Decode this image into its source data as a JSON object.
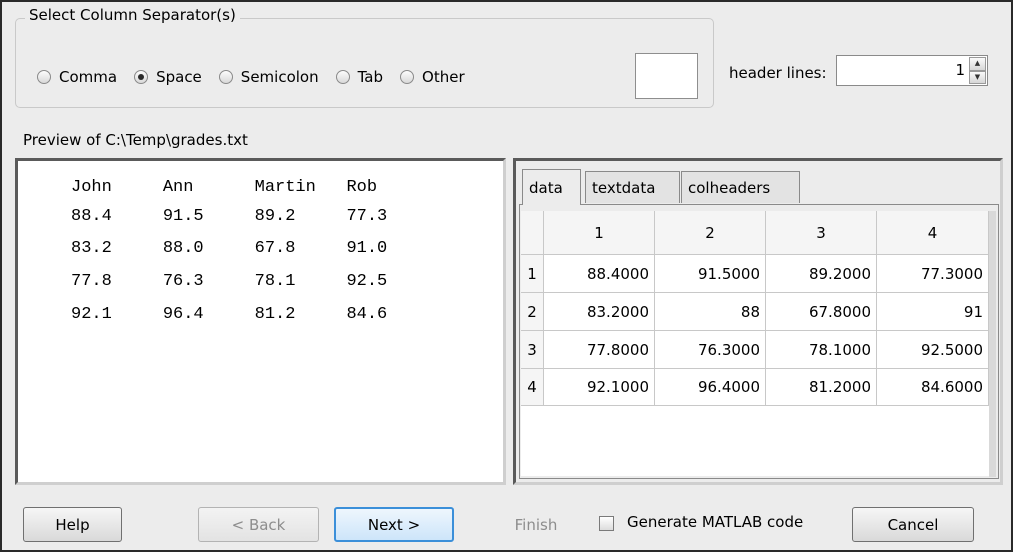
{
  "separator": {
    "title": "Select Column Separator(s)",
    "options": [
      {
        "label": "Comma",
        "checked": false
      },
      {
        "label": "Space",
        "checked": true
      },
      {
        "label": "Semicolon",
        "checked": false
      },
      {
        "label": "Tab",
        "checked": false
      },
      {
        "label": "Other",
        "checked": false
      }
    ],
    "other_value": ""
  },
  "header_lines": {
    "label": "header lines:",
    "value": "1"
  },
  "preview": {
    "label": "Preview of C:\\Temp\\grades.txt",
    "lines": [
      "John     Ann      Martin   Rob",
      "88.4     91.5     89.2     77.3",
      "83.2     88.0     67.8     91.0",
      "77.8     76.3     78.1     92.5",
      "92.1     96.4     81.2     84.6"
    ]
  },
  "tabs": [
    {
      "label": "data",
      "active": true
    },
    {
      "label": "textdata",
      "active": false
    },
    {
      "label": "colheaders",
      "active": false
    }
  ],
  "table": {
    "col_headers": [
      "1",
      "2",
      "3",
      "4"
    ],
    "row_headers": [
      "1",
      "2",
      "3",
      "4"
    ],
    "rows": [
      [
        "88.4000",
        "91.5000",
        "89.2000",
        "77.3000"
      ],
      [
        "83.2000",
        "88",
        "67.8000",
        "91"
      ],
      [
        "77.8000",
        "76.3000",
        "78.1000",
        "92.5000"
      ],
      [
        "92.1000",
        "96.4000",
        "81.2000",
        "84.6000"
      ]
    ]
  },
  "buttons": {
    "help": "Help",
    "back": "< Back",
    "next": "Next >",
    "finish": "Finish",
    "cancel": "Cancel"
  },
  "generate_code": {
    "label": "Generate MATLAB code",
    "checked": false
  }
}
